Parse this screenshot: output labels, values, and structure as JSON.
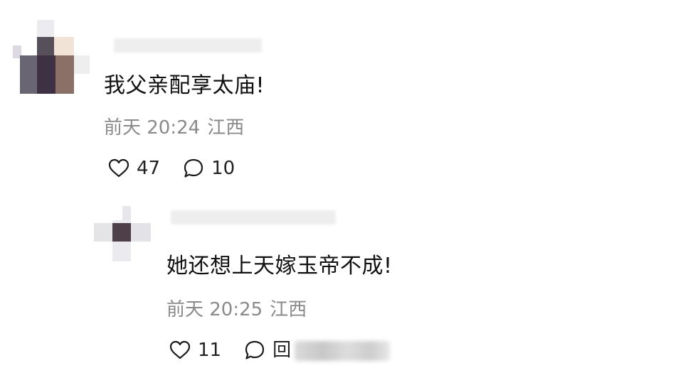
{
  "comments": [
    {
      "text": "我父亲配享太庙!",
      "time": "前天 20:24",
      "location": "江西",
      "likes": "47",
      "replies": "10"
    }
  ],
  "reply": {
    "text": "她还想上天嫁玉帝不成!",
    "time": "前天 20:25",
    "location": "江西",
    "likes": "11",
    "reply_label": "回"
  },
  "icons": {
    "like": "heart-outline-icon",
    "comment": "speech-bubble-outline-icon"
  },
  "colors": {
    "text": "#111111",
    "meta": "#8a8a8a",
    "background": "#ffffff"
  }
}
